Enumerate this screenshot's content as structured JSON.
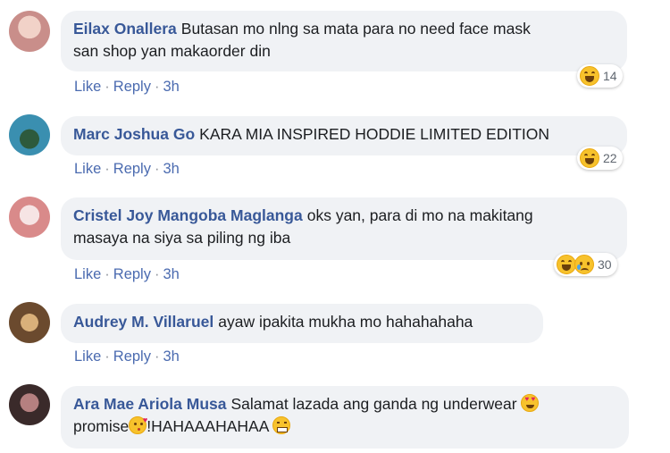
{
  "comments": [
    {
      "author": "Eilax Onallera",
      "text_line1": "Butasan mo nlng sa mata para no need face mask",
      "text_line2": "san shop yan makaorder din",
      "like": "Like",
      "reply": "Reply",
      "time": "3h",
      "reaction_count": "14",
      "avatar_colors": [
        "#c98e8a",
        "#f1d2c8"
      ]
    },
    {
      "author": "Marc Joshua Go",
      "text_line1": "KARA MIA INSPIRED HODDIE LIMITED EDITION",
      "like": "Like",
      "reply": "Reply",
      "time": "3h",
      "reaction_count": "22",
      "avatar_colors": [
        "#3a8fb0",
        "#2d5a3d"
      ]
    },
    {
      "author": "Cristel Joy Mangoba Maglanga",
      "text_line1": "oks yan, para di mo na makitang",
      "text_line2": "masaya na siya sa piling ng iba",
      "like": "Like",
      "reply": "Reply",
      "time": "3h",
      "reaction_count": "30",
      "avatar_colors": [
        "#d98a8a",
        "#f6e4e4"
      ]
    },
    {
      "author": "Audrey M. Villaruel",
      "text_line1": "ayaw ipakita mukha mo hahahahaha",
      "like": "Like",
      "reply": "Reply",
      "time": "3h",
      "avatar_colors": [
        "#6b4a2e",
        "#d9b07a"
      ]
    },
    {
      "author": "Ara Mae Ariola Musa",
      "text_line1": "Salamat lazada ang ganda ng underwear",
      "text_line2a": "promise",
      "text_line2b": "!HAHAAAHAHAA",
      "avatar_colors": [
        "#3a2a2a",
        "#b58080"
      ]
    }
  ],
  "icons": {
    "haha": "haha-reaction-icon",
    "sad": "sad-reaction-icon"
  },
  "colors": {
    "author": "#385898",
    "bubble": "#f0f2f5",
    "action": "#4b6bb0"
  }
}
